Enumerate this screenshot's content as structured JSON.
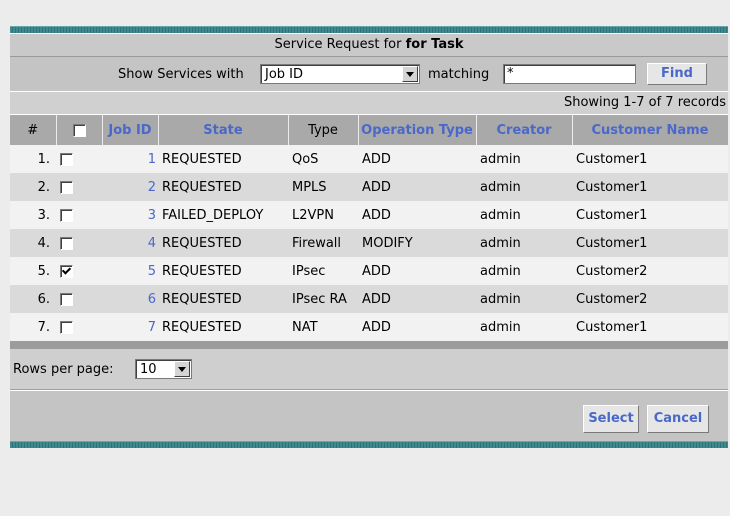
{
  "header": {
    "title_prefix": "Service Request for",
    "title_bold": "for Task"
  },
  "filter": {
    "label": "Show Services with",
    "field_selected": "Job ID",
    "matching_label": "matching",
    "matching_value": "*",
    "find_label": "Find"
  },
  "records_text": "Showing 1-7 of 7 records",
  "columns": {
    "num": "#",
    "job_id": "Job ID",
    "state": "State",
    "type": "Type",
    "operation_type": "Operation Type",
    "creator": "Creator",
    "customer_name": "Customer Name"
  },
  "rows": [
    {
      "num": "1.",
      "checked": false,
      "job_id": "1",
      "state": "REQUESTED",
      "type": "QoS",
      "operation_type": "ADD",
      "creator": "admin",
      "customer_name": "Customer1"
    },
    {
      "num": "2.",
      "checked": false,
      "job_id": "2",
      "state": "REQUESTED",
      "type": "MPLS",
      "operation_type": "ADD",
      "creator": "admin",
      "customer_name": "Customer1"
    },
    {
      "num": "3.",
      "checked": false,
      "job_id": "3",
      "state": "FAILED_DEPLOY",
      "type": "L2VPN",
      "operation_type": "ADD",
      "creator": "admin",
      "customer_name": "Customer1"
    },
    {
      "num": "4.",
      "checked": false,
      "job_id": "4",
      "state": "REQUESTED",
      "type": "Firewall",
      "operation_type": "MODIFY",
      "creator": "admin",
      "customer_name": "Customer1"
    },
    {
      "num": "5.",
      "checked": true,
      "job_id": "5",
      "state": "REQUESTED",
      "type": "IPsec",
      "operation_type": "ADD",
      "creator": "admin",
      "customer_name": "Customer2"
    },
    {
      "num": "6.",
      "checked": false,
      "job_id": "6",
      "state": "REQUESTED",
      "type": "IPsec RA",
      "operation_type": "ADD",
      "creator": "admin",
      "customer_name": "Customer2"
    },
    {
      "num": "7.",
      "checked": false,
      "job_id": "7",
      "state": "REQUESTED",
      "type": "NAT",
      "operation_type": "ADD",
      "creator": "admin",
      "customer_name": "Customer1"
    }
  ],
  "pagination": {
    "rows_per_page_label": "Rows per page:",
    "rows_per_page_value": "10"
  },
  "actions": {
    "select_label": "Select",
    "cancel_label": "Cancel"
  },
  "colors": {
    "link": "#4a68c9",
    "teal_bar": "#3f8a8f",
    "header_bg": "#a9a9a9"
  }
}
